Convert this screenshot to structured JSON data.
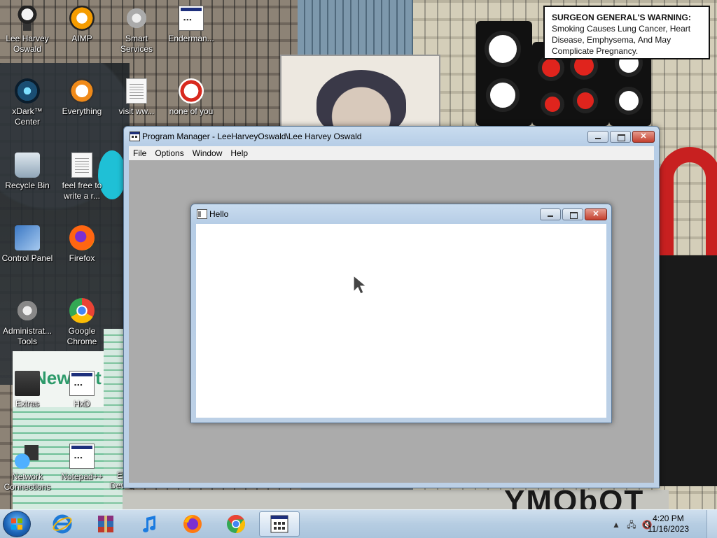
{
  "desktop": {
    "warning": {
      "bold": "SURGEON GENERAL'S WARNING:",
      "text": "Smoking Causes Lung Cancer, Heart Disease, Emphysema, And May Complicate Pregnancy."
    },
    "wallpaper_text": "YMObOT",
    "icons": [
      {
        "label": "Lee Harvey Oswald",
        "icon": "user-avatar-icon"
      },
      {
        "label": "AIMP",
        "icon": "aimp-icon"
      },
      {
        "label": "Smart Services",
        "icon": "gear-icon"
      },
      {
        "label": "Enderman...",
        "icon": "program-icon"
      },
      {
        "label": "xDark™ Center",
        "icon": "xdark-icon"
      },
      {
        "label": "Everything",
        "icon": "everything-icon"
      },
      {
        "label": "visit ww...",
        "icon": "document-icon"
      },
      {
        "label": "none of you",
        "icon": "program-icon"
      },
      {
        "label": "Recycle Bin",
        "icon": "recycle-bin-icon"
      },
      {
        "label": "feel free to write a r...",
        "icon": "document-icon"
      },
      {
        "label": "Control Panel",
        "icon": "control-panel-icon"
      },
      {
        "label": "Firefox",
        "icon": "firefox-icon"
      },
      {
        "label": "Administrat... Tools",
        "icon": "admin-tools-icon"
      },
      {
        "label": "Google Chrome",
        "icon": "chrome-icon"
      },
      {
        "label": "Extras",
        "icon": "folder-icon"
      },
      {
        "label": "HxD",
        "icon": "hxd-icon"
      },
      {
        "label": "Network Connections",
        "icon": "network-icon"
      },
      {
        "label": "Notepad++",
        "icon": "notepadpp-icon"
      },
      {
        "label": "Em... Dev-C++",
        "icon": "devcpp-icon"
      }
    ]
  },
  "program_manager": {
    "title": "Program Manager - LeeHarveyOswald\\Lee Harvey Oswald",
    "menu": [
      "File",
      "Options",
      "Window",
      "Help"
    ]
  },
  "hello_window": {
    "title": "Hello"
  },
  "taskbar": {
    "pinned": [
      "internet-explorer-icon",
      "winrar-icon",
      "itunes-icon",
      "firefox-icon",
      "chrome-icon",
      "program-manager-icon"
    ],
    "time": "4:20 PM",
    "date": "11/16/2023"
  },
  "colors": {
    "taskbar": "#b6cde2",
    "mdi_background": "#ababab",
    "close_button": "#c4402e"
  }
}
